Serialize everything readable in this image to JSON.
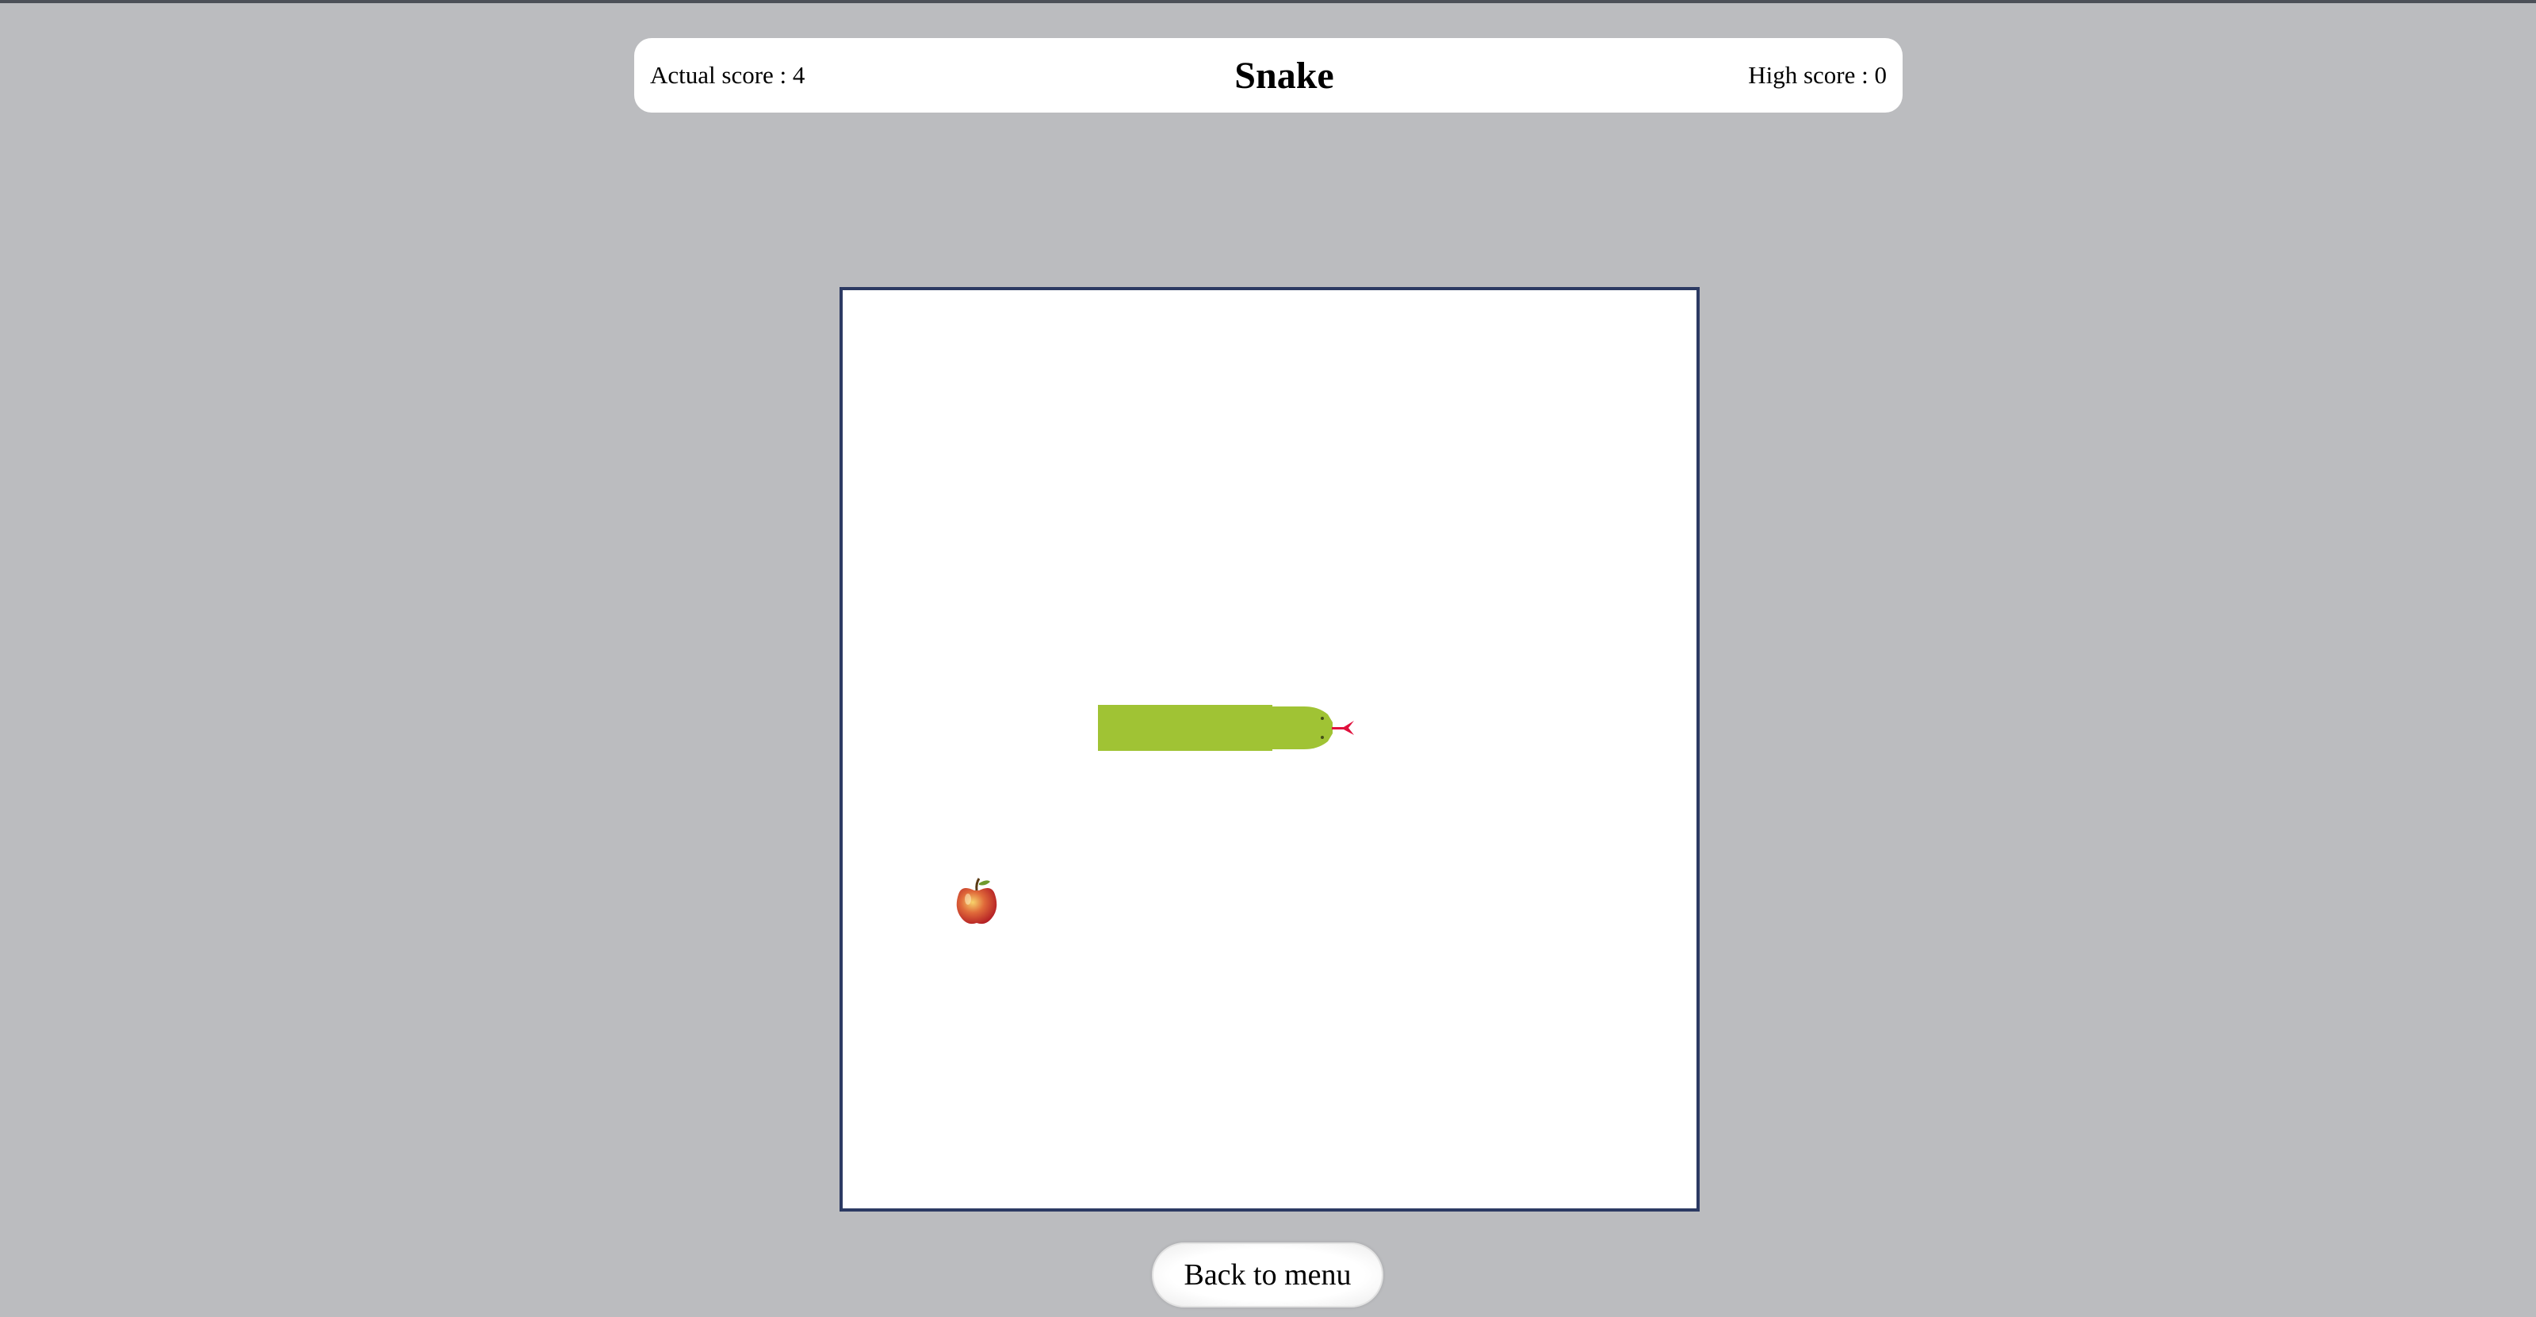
{
  "header": {
    "actual_score_label": "Actual score : 4",
    "title": "Snake",
    "high_score_label": "High score : 0"
  },
  "game": {
    "snake_color": "#a0c334",
    "tongue_color": "#e0103c",
    "board_border_color": "#2c3a63",
    "food_icon": "apple-icon"
  },
  "footer": {
    "back_label": "Back to menu"
  }
}
